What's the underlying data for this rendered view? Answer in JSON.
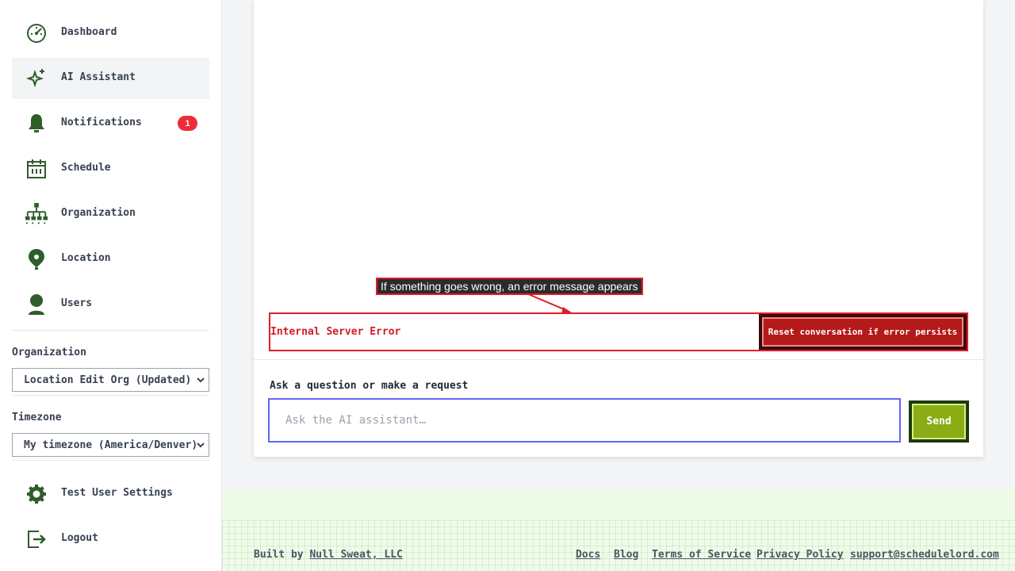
{
  "sidebar": {
    "items": [
      {
        "label": "Dashboard",
        "icon": "dashboard-icon"
      },
      {
        "label": "AI Assistant",
        "icon": "sparkle-icon",
        "active": true
      },
      {
        "label": "Notifications",
        "icon": "bell-icon",
        "badge": "1"
      },
      {
        "label": "Schedule",
        "icon": "calendar-icon"
      },
      {
        "label": "Organization",
        "icon": "org-chart-icon"
      },
      {
        "label": "Location",
        "icon": "map-pin-icon"
      },
      {
        "label": "Users",
        "icon": "user-icon"
      }
    ],
    "organization": {
      "label": "Organization",
      "value": "Location Edit Org (Updated)"
    },
    "timezone": {
      "label": "Timezone",
      "value": "My timezone (America/Denver)"
    },
    "bottom_items": [
      {
        "label": "Test User Settings",
        "icon": "gear-icon"
      },
      {
        "label": "Logout",
        "icon": "logout-icon"
      }
    ]
  },
  "main": {
    "callout": "If something goes wrong, an error message appears",
    "error_message": "Internal Server Error",
    "reset_button": "Reset conversation if error persists",
    "ask_label": "Ask a question or make a request",
    "ask_placeholder": "Ask the AI assistant…",
    "send_button": "Send"
  },
  "footer": {
    "built_by_prefix": "Built by",
    "built_by_link": "Null Sweat, LLC",
    "links": [
      "Docs",
      "Blog",
      "Terms of Service",
      "Privacy Policy",
      "support@schedulelord.com"
    ]
  },
  "colors": {
    "icon_green": "#2f5d2a",
    "error_red": "#e11d2a",
    "accent_indigo": "#6366f1",
    "send_green": "#8aac14"
  }
}
